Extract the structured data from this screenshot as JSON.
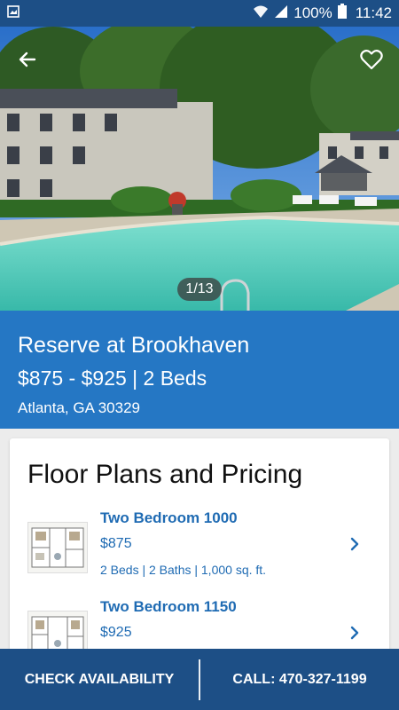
{
  "status_bar": {
    "battery": "100%",
    "time": "11:42",
    "icons": [
      "gallery-icon",
      "wifi-icon",
      "signal-icon",
      "battery-icon"
    ]
  },
  "hero": {
    "counter": "1/13",
    "back_icon": "arrow-left-icon",
    "favorite_icon": "heart-outline-icon"
  },
  "property": {
    "name": "Reserve at Brookhaven",
    "price_beds": "$875 - $925 | 2 Beds",
    "address": "Atlanta, GA 30329"
  },
  "floor_plans": {
    "heading": "Floor Plans and Pricing",
    "items": [
      {
        "name": "Two Bedroom 1000",
        "price": "$875",
        "details": "2 Beds | 2 Baths | 1,000 sq. ft."
      },
      {
        "name": "Two Bedroom 1150",
        "price": "$925",
        "details": ""
      }
    ]
  },
  "bottom_bar": {
    "check_availability": "CHECK AVAILABILITY",
    "call": "CALL: 470-327-1199"
  },
  "colors": {
    "status_bar": "#1d4f86",
    "info_banner": "#2577c4",
    "link_blue": "#1f6bb3",
    "bottom_bar": "#1d4f86"
  }
}
